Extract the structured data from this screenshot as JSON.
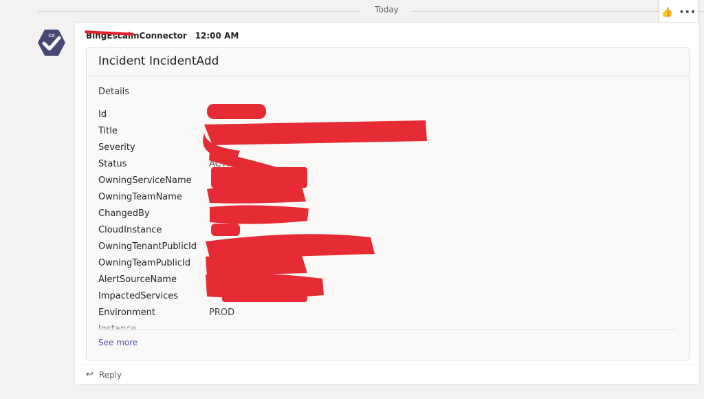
{
  "divider": {
    "label": "Today"
  },
  "reactions": {
    "like_icon": "👍",
    "more_icon": "•••"
  },
  "message": {
    "sender": "BingEscalmConnector",
    "timestamp": "12:00 AM"
  },
  "card": {
    "title": "Incident IncidentAdd",
    "section_label": "Details",
    "facts": [
      {
        "key": "Id",
        "value": ""
      },
      {
        "key": "Title",
        "value": ""
      },
      {
        "key": "Severity",
        "value": ""
      },
      {
        "key": "Status",
        "value": "ACTIVE"
      },
      {
        "key": "OwningServiceName",
        "value": ""
      },
      {
        "key": "OwningTeamName",
        "value": ""
      },
      {
        "key": "ChangedBy",
        "value": ""
      },
      {
        "key": "CloudInstance",
        "value": ""
      },
      {
        "key": "OwningTenantPublicId",
        "value": ""
      },
      {
        "key": "OwningTeamPublicId",
        "value": ""
      },
      {
        "key": "AlertSourceName",
        "value": ""
      },
      {
        "key": "ImpactedServices",
        "value": ""
      },
      {
        "key": "Environment",
        "value": "PROD"
      },
      {
        "key": "Instance",
        "value": ""
      }
    ],
    "see_more": "See more"
  },
  "reply": {
    "label": "Reply"
  },
  "colors": {
    "accent": "#4f52b2",
    "avatar": "#464775",
    "redaction": "#e5202a"
  }
}
